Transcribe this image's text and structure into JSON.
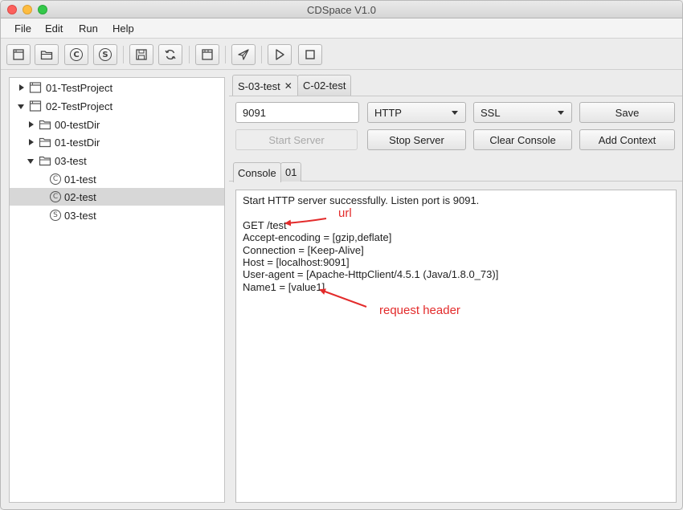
{
  "window": {
    "title": "CDSpace V1.0"
  },
  "menu": {
    "file": "File",
    "edit": "Edit",
    "run": "Run",
    "help": "Help"
  },
  "toolbar": {
    "icons": [
      "new-window-icon",
      "open-folder-icon",
      "client-c-icon",
      "server-s-icon",
      "save-icon",
      "refresh-icon",
      "window-icon",
      "send-icon",
      "play-icon",
      "stop-icon"
    ],
    "client_glyph": "C",
    "server_glyph": "S"
  },
  "tree": {
    "items": [
      {
        "label": "01-TestProject"
      },
      {
        "label": "02-TestProject"
      },
      {
        "label": "00-testDir"
      },
      {
        "label": "01-testDir"
      },
      {
        "label": "03-test"
      },
      {
        "label": "01-test",
        "glyph": "C"
      },
      {
        "label": "02-test",
        "glyph": "C"
      },
      {
        "label": "03-test",
        "glyph": "S"
      }
    ]
  },
  "tabs": {
    "server_tab": "S-03-test",
    "close_glyph": "✕",
    "client_tab": "C-02-test"
  },
  "controls": {
    "port": "9091",
    "protocol": "HTTP",
    "ssl": "SSL",
    "save": "Save",
    "start_server": "Start Server",
    "stop_server": "Stop Server",
    "clear_console": "Clear Console",
    "add_context": "Add Context"
  },
  "subtabs": {
    "console": "Console",
    "one": "01"
  },
  "console": {
    "lines": [
      "Start HTTP server successfully. Listen port is 9091.",
      "",
      "GET /test",
      "Accept-encoding = [gzip,deflate]",
      "Connection = [Keep-Alive]",
      "Host = [localhost:9091]",
      "User-agent = [Apache-HttpClient/4.5.1 (Java/1.8.0_73)]",
      "Name1 = [value1]"
    ]
  },
  "annotations": {
    "url": "url",
    "request_header": "request header",
    "color": "#e32b2b"
  }
}
